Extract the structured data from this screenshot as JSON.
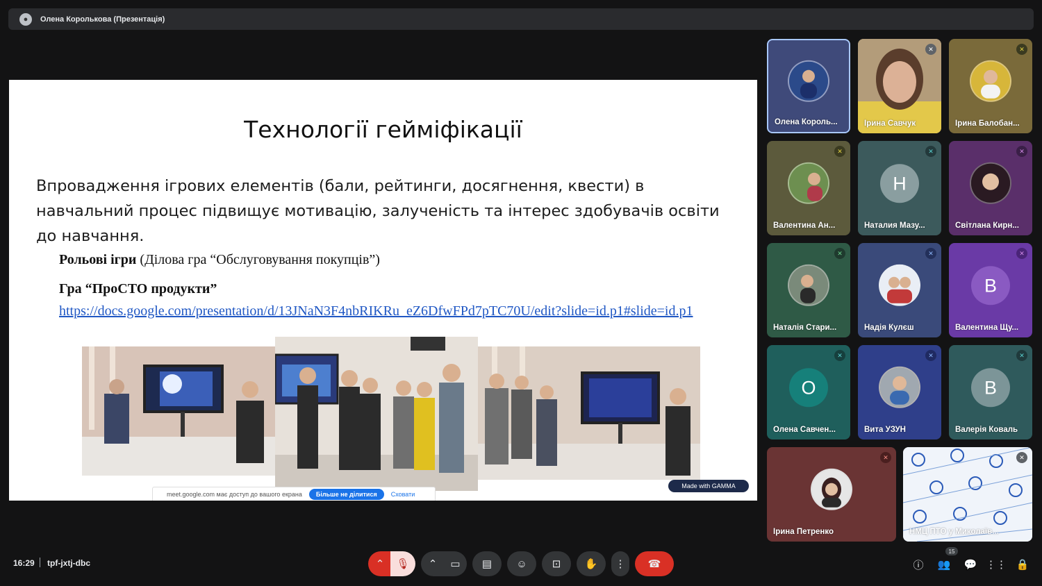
{
  "topbar": {
    "presenter_label": "Олена Королькова (Презентація)"
  },
  "slide": {
    "title": "Технології гейміфікації",
    "body": "Впровадження ігрових елементів (бали, рейтинги, досягнення, квести) в навчальний процес підвищує мотивацію, залученість та інтерес здобувачів освіти до навчання.",
    "role_games_bold": "Рольові ігри",
    "role_games_rest": " (Ділова гра “Обслуговування покупців”)",
    "game_title": "Гра “ПроСТО продукти”",
    "game_link": "https://docs.google.com/presentation/d/13JNaN3F4nbRIKRu_eZ6DfwFPd7pTC70U/edit?slide=id.p1#slide=id.p1",
    "share_bar_text": "meet.google.com має доступ до вашого екрана",
    "share_bar_stop": "Більше не ділитися",
    "share_bar_hide": "Сховати",
    "gamma_badge": "Made with GAMMA"
  },
  "participants": [
    {
      "name": "Олена Король...",
      "avatar": "photo",
      "color": "#3f4a7a",
      "mic": "none"
    },
    {
      "name": "Ірина Савчук",
      "avatar": "video",
      "color": "#8a7a5c",
      "mic": "muted-gray"
    },
    {
      "name": "Ірина Балобан...",
      "avatar": "photo",
      "color": "#7a6a3a",
      "mic": "muted-yellow"
    },
    {
      "name": "Валентина Ан...",
      "avatar": "photo",
      "color": "#5c5a3c",
      "mic": "muted-yellow"
    },
    {
      "name": "Наталия Мазу...",
      "avatar": "H",
      "color": "#3c5a5c",
      "mic": "muted-teal"
    },
    {
      "name": "Світлана Кирн...",
      "avatar": "photo",
      "color": "#5a2f6a",
      "mic": "muted-purple"
    },
    {
      "name": "Наталія Стари...",
      "avatar": "photo",
      "color": "#2f5a46",
      "mic": "muted-green"
    },
    {
      "name": "Надія Кулєш",
      "avatar": "photo",
      "color": "#3a4a7a",
      "mic": "muted-blue"
    },
    {
      "name": "Валентина Щу...",
      "avatar": "B",
      "color": "#6a3aa6",
      "mic": "muted-purple"
    },
    {
      "name": "Олена Савчен...",
      "avatar": "O",
      "color": "#1f5f5c",
      "mic": "muted-teal"
    },
    {
      "name": "Вита УЗУН",
      "avatar": "photo",
      "color": "#2f3f8a",
      "mic": "muted-blue"
    },
    {
      "name": "Валерія Коваль",
      "avatar": "B",
      "color": "#2f5a5c",
      "mic": "muted-teal"
    },
    {
      "name": "Ірина Петренко",
      "avatar": "photo",
      "color": "#6a3434",
      "mic": "muted-red"
    },
    {
      "name": "НМЦ ПТО у Миколаїв...",
      "avatar": "pattern",
      "color": "#e8eef6",
      "mic": "muted-gray"
    }
  ],
  "bottom": {
    "time": "16:29",
    "meeting_code": "tpf-jxtj-dbc",
    "participant_count": "15"
  },
  "controls": {
    "icons": [
      "chevron-up-icon",
      "mic-off-icon",
      "chevron-up-icon",
      "camera-icon",
      "captions-icon",
      "emoji-icon",
      "present-icon",
      "raise-hand-icon",
      "more-icon",
      "end-call-icon"
    ],
    "right_icons": [
      "info-icon",
      "people-icon",
      "chat-icon",
      "apps-icon",
      "lock-icon"
    ]
  }
}
